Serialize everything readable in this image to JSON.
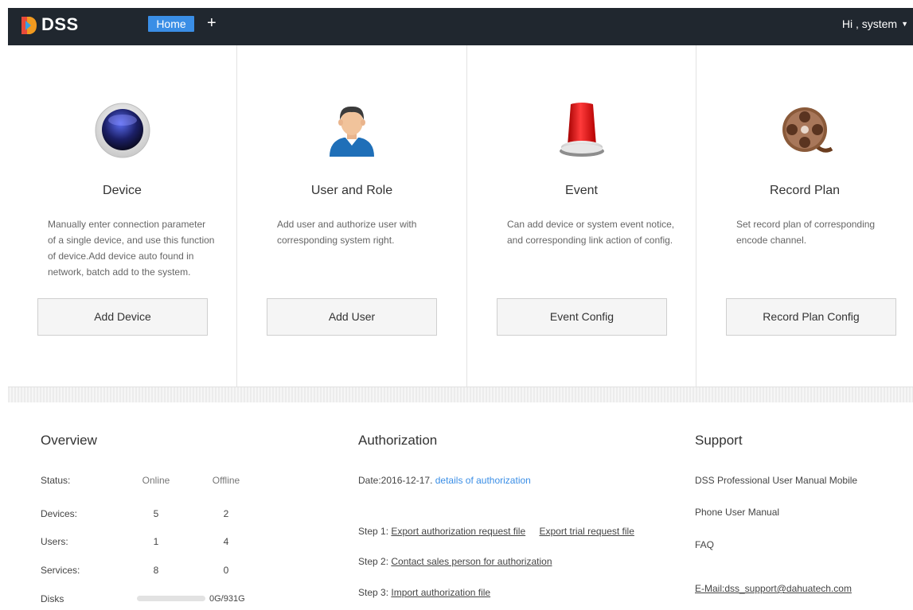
{
  "header": {
    "brand": "DSS",
    "home_tab": "Home",
    "add_tab": "+",
    "user_greeting": "Hi , system",
    "caret": "▼"
  },
  "cards": [
    {
      "icon": "camera-lens-icon",
      "title": "Device",
      "description": "Manually enter connection parameter of a single device, and use this function of device.Add device auto found in network, batch add to the system.",
      "button": "Add Device"
    },
    {
      "icon": "user-avatar-icon",
      "title": "User and Role",
      "description": "Add user and authorize user with corresponding system right.",
      "button": "Add User"
    },
    {
      "icon": "alarm-siren-icon",
      "title": "Event",
      "description": "Can add device or system event notice, and corresponding link action of config.",
      "button": "Event Config"
    },
    {
      "icon": "film-reel-icon",
      "title": "Record Plan",
      "description": "Set record plan of corresponding encode channel.",
      "button": "Record Plan Config"
    }
  ],
  "overview": {
    "title": "Overview",
    "header": {
      "label": "Status:",
      "col1": "Online",
      "col2": "Offline"
    },
    "rows": [
      {
        "label": "Devices:",
        "online": "5",
        "offline": "2"
      },
      {
        "label": "Users:",
        "online": "1",
        "offline": "4"
      },
      {
        "label": "Services:",
        "online": "8",
        "offline": "0"
      }
    ],
    "disks": {
      "label": "Disks",
      "value": "0G/931G",
      "used_fraction": 0
    }
  },
  "authorization": {
    "title": "Authorization",
    "date_text": "Date:2016-12-17.",
    "details_link": "details of authorization",
    "step1_label": "Step 1:",
    "step1_link_a": "Export authorization request file",
    "step1_link_b": "Export trial request file",
    "step2_label": "Step 2:",
    "step2_link": "Contact sales person for authorization",
    "step3_label": "Step 3:",
    "step3_link": "Import authorization file"
  },
  "support": {
    "title": "Support",
    "line1": "DSS Professional User Manual Mobile",
    "line2": "Phone User Manual",
    "faq": "FAQ",
    "email": "E-Mail:dss_support@dahuatech.com"
  },
  "colors": {
    "topbar": "#20272f",
    "accent": "#3a8ee6"
  }
}
